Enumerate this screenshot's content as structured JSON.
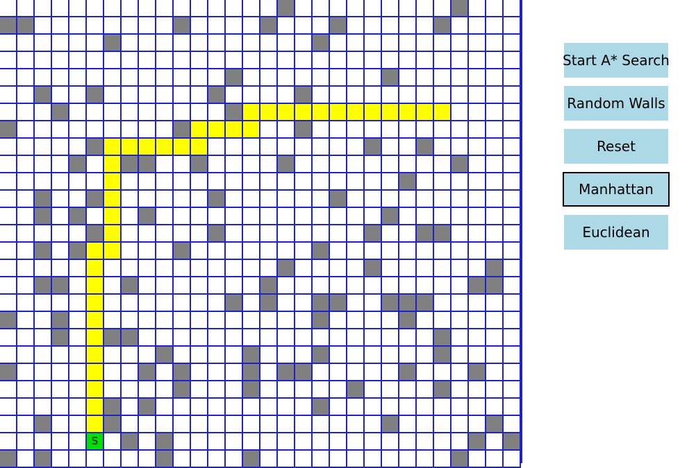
{
  "grid": {
    "cols": 30,
    "rows": 27,
    "colors": {
      "line": "#1f22c8",
      "wall": "#808080",
      "path": "#ffff00",
      "start": "#00e000",
      "empty": "#ffffff"
    },
    "start": {
      "row": 25,
      "col": 5,
      "label": "S"
    },
    "walls": [
      [
        0,
        16
      ],
      [
        0,
        26
      ],
      [
        1,
        0
      ],
      [
        1,
        1
      ],
      [
        1,
        10
      ],
      [
        1,
        15
      ],
      [
        1,
        19
      ],
      [
        1,
        25
      ],
      [
        2,
        6
      ],
      [
        2,
        18
      ],
      [
        4,
        13
      ],
      [
        4,
        22
      ],
      [
        5,
        2
      ],
      [
        5,
        5
      ],
      [
        5,
        12
      ],
      [
        5,
        17
      ],
      [
        6,
        3
      ],
      [
        6,
        13
      ],
      [
        7,
        0
      ],
      [
        7,
        10
      ],
      [
        7,
        17
      ],
      [
        8,
        5
      ],
      [
        8,
        21
      ],
      [
        8,
        24
      ],
      [
        9,
        4
      ],
      [
        9,
        7
      ],
      [
        9,
        8
      ],
      [
        9,
        11
      ],
      [
        9,
        16
      ],
      [
        9,
        26
      ],
      [
        10,
        23
      ],
      [
        11,
        2
      ],
      [
        11,
        5
      ],
      [
        11,
        12
      ],
      [
        11,
        19
      ],
      [
        12,
        2
      ],
      [
        12,
        4
      ],
      [
        12,
        8
      ],
      [
        12,
        22
      ],
      [
        13,
        5
      ],
      [
        13,
        12
      ],
      [
        13,
        21
      ],
      [
        13,
        24
      ],
      [
        13,
        25
      ],
      [
        14,
        2
      ],
      [
        14,
        4
      ],
      [
        14,
        10
      ],
      [
        14,
        18
      ],
      [
        15,
        16
      ],
      [
        15,
        21
      ],
      [
        15,
        28
      ],
      [
        16,
        2
      ],
      [
        16,
        3
      ],
      [
        16,
        7
      ],
      [
        16,
        15
      ],
      [
        16,
        27
      ],
      [
        16,
        28
      ],
      [
        17,
        13
      ],
      [
        17,
        15
      ],
      [
        17,
        18
      ],
      [
        17,
        19
      ],
      [
        17,
        22
      ],
      [
        17,
        23
      ],
      [
        17,
        24
      ],
      [
        18,
        0
      ],
      [
        18,
        3
      ],
      [
        18,
        18
      ],
      [
        18,
        23
      ],
      [
        19,
        3
      ],
      [
        19,
        6
      ],
      [
        19,
        7
      ],
      [
        19,
        25
      ],
      [
        20,
        9
      ],
      [
        20,
        14
      ],
      [
        20,
        18
      ],
      [
        20,
        25
      ],
      [
        21,
        0
      ],
      [
        21,
        8
      ],
      [
        21,
        10
      ],
      [
        21,
        14
      ],
      [
        21,
        16
      ],
      [
        21,
        17
      ],
      [
        21,
        23
      ],
      [
        21,
        27
      ],
      [
        22,
        10
      ],
      [
        22,
        14
      ],
      [
        22,
        20
      ],
      [
        22,
        25
      ],
      [
        23,
        6
      ],
      [
        23,
        8
      ],
      [
        23,
        18
      ],
      [
        24,
        2
      ],
      [
        24,
        6
      ],
      [
        24,
        22
      ],
      [
        24,
        28
      ],
      [
        25,
        7
      ],
      [
        25,
        9
      ],
      [
        25,
        27
      ],
      [
        25,
        29
      ],
      [
        26,
        0
      ],
      [
        26,
        2
      ],
      [
        26,
        9
      ],
      [
        26,
        14
      ],
      [
        26,
        26
      ]
    ],
    "path": [
      [
        6,
        14
      ],
      [
        6,
        15
      ],
      [
        6,
        16
      ],
      [
        6,
        17
      ],
      [
        6,
        18
      ],
      [
        6,
        19
      ],
      [
        6,
        20
      ],
      [
        6,
        21
      ],
      [
        6,
        22
      ],
      [
        6,
        23
      ],
      [
        6,
        24
      ],
      [
        6,
        25
      ],
      [
        7,
        11
      ],
      [
        7,
        12
      ],
      [
        7,
        13
      ],
      [
        7,
        14
      ],
      [
        8,
        6
      ],
      [
        8,
        7
      ],
      [
        8,
        8
      ],
      [
        8,
        9
      ],
      [
        8,
        10
      ],
      [
        8,
        11
      ],
      [
        9,
        6
      ],
      [
        10,
        6
      ],
      [
        11,
        6
      ],
      [
        12,
        6
      ],
      [
        13,
        6
      ],
      [
        14,
        5
      ],
      [
        14,
        6
      ],
      [
        15,
        5
      ],
      [
        16,
        5
      ],
      [
        17,
        5
      ],
      [
        18,
        5
      ],
      [
        19,
        5
      ],
      [
        20,
        5
      ],
      [
        21,
        5
      ],
      [
        22,
        5
      ],
      [
        23,
        5
      ],
      [
        24,
        5
      ]
    ]
  },
  "controls": {
    "buttons": [
      {
        "name": "start-search-button",
        "label": "Start A* Search",
        "selected": false
      },
      {
        "name": "random-walls-button",
        "label": "Random Walls",
        "selected": false
      },
      {
        "name": "reset-button",
        "label": "Reset",
        "selected": false
      },
      {
        "name": "manhattan-button",
        "label": "Manhattan",
        "selected": true
      },
      {
        "name": "euclidean-button",
        "label": "Euclidean",
        "selected": false
      }
    ],
    "button_color": "#add8e6"
  }
}
